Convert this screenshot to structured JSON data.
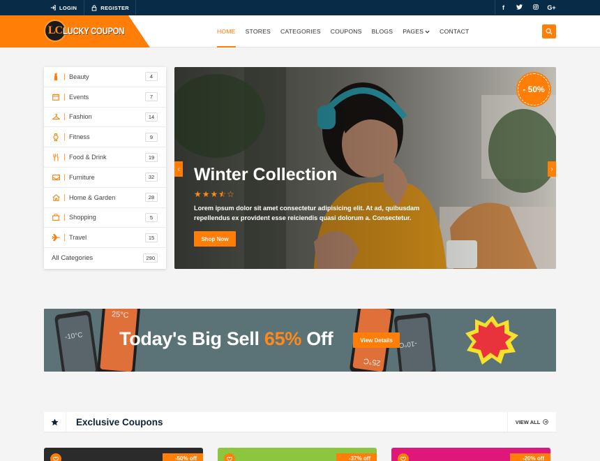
{
  "topbar": {
    "login": "LOGIN",
    "register": "REGISTER",
    "social": [
      "facebook-icon",
      "twitter-icon",
      "instagram-icon",
      "google-plus-icon"
    ],
    "social_glyphs": [
      "f",
      "t",
      "◎",
      "G+"
    ]
  },
  "brand": {
    "mark": "LC",
    "name": "LUCKY COUPON",
    "accent": "#ff7e08",
    "dark": "#082c47"
  },
  "nav": {
    "items": [
      "HOME",
      "STORES",
      "CATEGORIES",
      "COUPONS",
      "BLOGS",
      "PAGES",
      "CONTACT"
    ],
    "active": "HOME"
  },
  "sidebar": {
    "categories": [
      {
        "label": "Beauty",
        "count": "4",
        "icon": "lipstick-icon"
      },
      {
        "label": "Events",
        "count": "7",
        "icon": "calendar-icon"
      },
      {
        "label": "Fashion",
        "count": "14",
        "icon": "hanger-icon"
      },
      {
        "label": "Fitness",
        "count": "9",
        "icon": "watch-icon"
      },
      {
        "label": "Food & Drink",
        "count": "19",
        "icon": "cutlery-icon"
      },
      {
        "label": "Furniture",
        "count": "32",
        "icon": "sofa-icon"
      },
      {
        "label": "Home & Garden",
        "count": "28",
        "icon": "home-icon"
      },
      {
        "label": "Shopping",
        "count": "5",
        "icon": "shopping-bag-icon"
      },
      {
        "label": "Travel",
        "count": "15",
        "icon": "airplane-icon"
      }
    ],
    "all": {
      "label": "All Categories",
      "count": "290"
    }
  },
  "hero": {
    "title": "Winter Collection",
    "rating": 3.5,
    "text": "Lorem ipsum dolor sit amet consectetur adipisicing elit. At ad, quibusdam repellendus ex provident esse reiciendis quasi dolorum a. Consectetur.",
    "button": "Shop Now",
    "badge": "- 50%"
  },
  "promo": {
    "title_a": "Today's Big Sell ",
    "title_hl": "65%",
    "title_b": " Off",
    "button": "View Details",
    "phone_texts": [
      "25°C",
      "-10°C",
      "-10°C",
      "25°C"
    ]
  },
  "exclusive": {
    "title": "Exclusive Coupons",
    "view_all": "VIEW ALL",
    "coupons": [
      {
        "off": "-50% off",
        "color": "#2b2b2b"
      },
      {
        "off": "-37% off",
        "color": "#8cc63f"
      },
      {
        "off": "-20% off",
        "color": "#e0177a"
      }
    ]
  }
}
